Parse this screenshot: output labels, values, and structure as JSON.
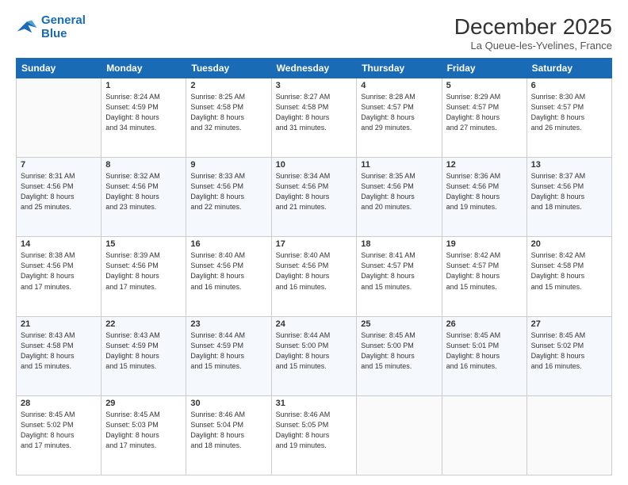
{
  "header": {
    "logo_line1": "General",
    "logo_line2": "Blue",
    "month": "December 2025",
    "location": "La Queue-les-Yvelines, France"
  },
  "days_of_week": [
    "Sunday",
    "Monday",
    "Tuesday",
    "Wednesday",
    "Thursday",
    "Friday",
    "Saturday"
  ],
  "weeks": [
    [
      {
        "day": "",
        "content": ""
      },
      {
        "day": "1",
        "content": "Sunrise: 8:24 AM\nSunset: 4:59 PM\nDaylight: 8 hours\nand 34 minutes."
      },
      {
        "day": "2",
        "content": "Sunrise: 8:25 AM\nSunset: 4:58 PM\nDaylight: 8 hours\nand 32 minutes."
      },
      {
        "day": "3",
        "content": "Sunrise: 8:27 AM\nSunset: 4:58 PM\nDaylight: 8 hours\nand 31 minutes."
      },
      {
        "day": "4",
        "content": "Sunrise: 8:28 AM\nSunset: 4:57 PM\nDaylight: 8 hours\nand 29 minutes."
      },
      {
        "day": "5",
        "content": "Sunrise: 8:29 AM\nSunset: 4:57 PM\nDaylight: 8 hours\nand 27 minutes."
      },
      {
        "day": "6",
        "content": "Sunrise: 8:30 AM\nSunset: 4:57 PM\nDaylight: 8 hours\nand 26 minutes."
      }
    ],
    [
      {
        "day": "7",
        "content": "Sunrise: 8:31 AM\nSunset: 4:56 PM\nDaylight: 8 hours\nand 25 minutes."
      },
      {
        "day": "8",
        "content": "Sunrise: 8:32 AM\nSunset: 4:56 PM\nDaylight: 8 hours\nand 23 minutes."
      },
      {
        "day": "9",
        "content": "Sunrise: 8:33 AM\nSunset: 4:56 PM\nDaylight: 8 hours\nand 22 minutes."
      },
      {
        "day": "10",
        "content": "Sunrise: 8:34 AM\nSunset: 4:56 PM\nDaylight: 8 hours\nand 21 minutes."
      },
      {
        "day": "11",
        "content": "Sunrise: 8:35 AM\nSunset: 4:56 PM\nDaylight: 8 hours\nand 20 minutes."
      },
      {
        "day": "12",
        "content": "Sunrise: 8:36 AM\nSunset: 4:56 PM\nDaylight: 8 hours\nand 19 minutes."
      },
      {
        "day": "13",
        "content": "Sunrise: 8:37 AM\nSunset: 4:56 PM\nDaylight: 8 hours\nand 18 minutes."
      }
    ],
    [
      {
        "day": "14",
        "content": "Sunrise: 8:38 AM\nSunset: 4:56 PM\nDaylight: 8 hours\nand 17 minutes."
      },
      {
        "day": "15",
        "content": "Sunrise: 8:39 AM\nSunset: 4:56 PM\nDaylight: 8 hours\nand 17 minutes."
      },
      {
        "day": "16",
        "content": "Sunrise: 8:40 AM\nSunset: 4:56 PM\nDaylight: 8 hours\nand 16 minutes."
      },
      {
        "day": "17",
        "content": "Sunrise: 8:40 AM\nSunset: 4:56 PM\nDaylight: 8 hours\nand 16 minutes."
      },
      {
        "day": "18",
        "content": "Sunrise: 8:41 AM\nSunset: 4:57 PM\nDaylight: 8 hours\nand 15 minutes."
      },
      {
        "day": "19",
        "content": "Sunrise: 8:42 AM\nSunset: 4:57 PM\nDaylight: 8 hours\nand 15 minutes."
      },
      {
        "day": "20",
        "content": "Sunrise: 8:42 AM\nSunset: 4:58 PM\nDaylight: 8 hours\nand 15 minutes."
      }
    ],
    [
      {
        "day": "21",
        "content": "Sunrise: 8:43 AM\nSunset: 4:58 PM\nDaylight: 8 hours\nand 15 minutes."
      },
      {
        "day": "22",
        "content": "Sunrise: 8:43 AM\nSunset: 4:59 PM\nDaylight: 8 hours\nand 15 minutes."
      },
      {
        "day": "23",
        "content": "Sunrise: 8:44 AM\nSunset: 4:59 PM\nDaylight: 8 hours\nand 15 minutes."
      },
      {
        "day": "24",
        "content": "Sunrise: 8:44 AM\nSunset: 5:00 PM\nDaylight: 8 hours\nand 15 minutes."
      },
      {
        "day": "25",
        "content": "Sunrise: 8:45 AM\nSunset: 5:00 PM\nDaylight: 8 hours\nand 15 minutes."
      },
      {
        "day": "26",
        "content": "Sunrise: 8:45 AM\nSunset: 5:01 PM\nDaylight: 8 hours\nand 16 minutes."
      },
      {
        "day": "27",
        "content": "Sunrise: 8:45 AM\nSunset: 5:02 PM\nDaylight: 8 hours\nand 16 minutes."
      }
    ],
    [
      {
        "day": "28",
        "content": "Sunrise: 8:45 AM\nSunset: 5:02 PM\nDaylight: 8 hours\nand 17 minutes."
      },
      {
        "day": "29",
        "content": "Sunrise: 8:45 AM\nSunset: 5:03 PM\nDaylight: 8 hours\nand 17 minutes."
      },
      {
        "day": "30",
        "content": "Sunrise: 8:46 AM\nSunset: 5:04 PM\nDaylight: 8 hours\nand 18 minutes."
      },
      {
        "day": "31",
        "content": "Sunrise: 8:46 AM\nSunset: 5:05 PM\nDaylight: 8 hours\nand 19 minutes."
      },
      {
        "day": "",
        "content": ""
      },
      {
        "day": "",
        "content": ""
      },
      {
        "day": "",
        "content": ""
      }
    ]
  ]
}
